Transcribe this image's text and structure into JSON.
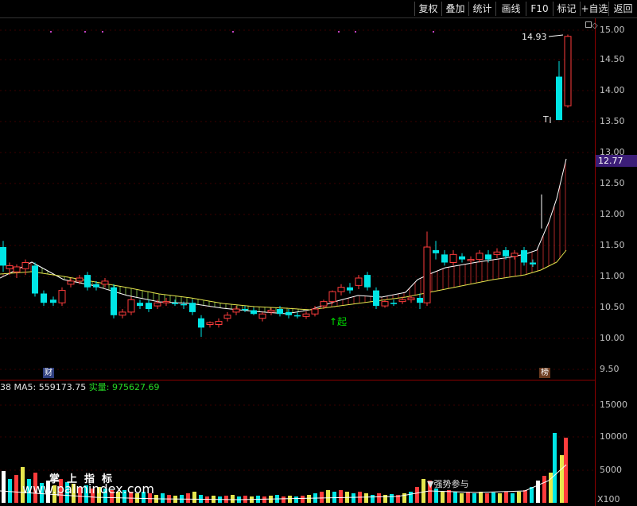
{
  "toolbar": {
    "buttons": [
      "复权",
      "叠加",
      "统计",
      "画线",
      "F10",
      "标记",
      "+自选",
      "返回"
    ]
  },
  "price_axis": {
    "ticks": [
      "15.00",
      "14.50",
      "14.00",
      "13.50",
      "13.00",
      "12.50",
      "12.00",
      "11.50",
      "11.00",
      "10.50",
      "10.00",
      "9.50"
    ],
    "current_price": "12.77",
    "high_label": "14.93",
    "low_marker": "T"
  },
  "volume_axis": {
    "ticks": [
      "15000",
      "10000",
      "5000"
    ],
    "scale": "X100"
  },
  "volume_info": {
    "prefix": "38",
    "ma5_label": "MA5:",
    "ma5_value": "559173.75",
    "actual_label": "实量:",
    "actual_value": "975627.69"
  },
  "markers": {
    "qi": "↑起",
    "cai": "财",
    "bang": "榜",
    "strong": "▼强势参与"
  },
  "watermark": {
    "cn": "掌上指标",
    "url": "www.palmindex.com"
  },
  "colors": {
    "up": "#ff3c3c",
    "down": "#00e5e5",
    "ma_white": "#ffffff",
    "ma_yellow": "#e6e64d",
    "axis": "#8b0000"
  }
}
